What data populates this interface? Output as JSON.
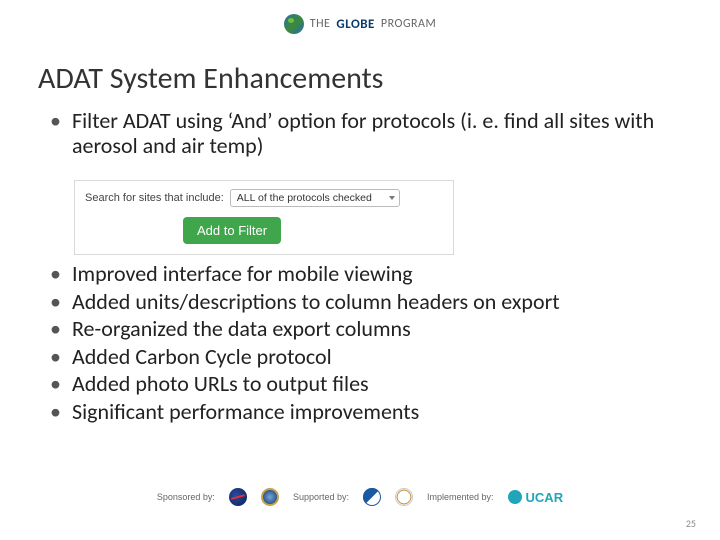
{
  "header": {
    "logo_prefix": "THE",
    "logo_name": "GLOBE",
    "logo_suffix": "PROGRAM"
  },
  "title": "ADAT System Enhancements",
  "bullet_first": "Filter ADAT using ‘And’ option for protocols (i. e. find all sites with aerosol and air temp)",
  "ui_snippet": {
    "label": "Search for sites that include:",
    "select_value": "ALL of the protocols checked",
    "button": "Add to Filter"
  },
  "bullets_rest": [
    "Improved interface for mobile viewing",
    "Added units/descriptions to column headers on export",
    "Re-organized the data export columns",
    "Added Carbon Cycle protocol",
    "Added photo URLs to output files",
    "Significant performance improvements"
  ],
  "footer": {
    "sponsored": "Sponsored by:",
    "supported": "Supported by:",
    "implemented": "Implemented by:",
    "ucar": "UCAR"
  },
  "page_number": "25"
}
